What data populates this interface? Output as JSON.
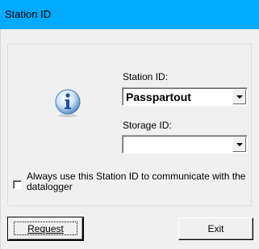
{
  "window": {
    "title": "Station ID",
    "title_bar_color": "#00aaff"
  },
  "icon": {
    "name": "info-icon",
    "glyph": "i"
  },
  "station": {
    "label": "Station ID:",
    "value": "Passpartout"
  },
  "storage": {
    "label": "Storage ID:",
    "value": ""
  },
  "options": {
    "always_use_label": "Always use this Station ID to communicate with the datalogger",
    "always_use_checked": false
  },
  "buttons": {
    "request": "Request",
    "exit": "Exit"
  }
}
